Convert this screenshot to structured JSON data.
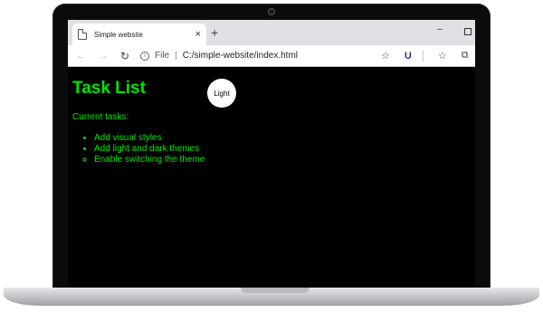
{
  "browser": {
    "tab_title": "Simple website",
    "tab_close": "×",
    "new_tab": "+",
    "minimize": "–",
    "file_label": "File",
    "address_separator": "|",
    "url": "C:/simple-website/index.html",
    "icons": [
      "back-arrow-icon",
      "forward-arrow-icon",
      "reload-icon",
      "info-icon",
      "favorite-star-icon",
      "extension-icon",
      "favorites-icon",
      "collections-icon"
    ]
  },
  "page": {
    "title": "Task List",
    "theme_button_label": "Light",
    "subheading": "Current tasks:",
    "tasks": [
      {
        "label": "Add visual styles",
        "status": "done"
      },
      {
        "label": "Add light and dark themes",
        "status": "done"
      },
      {
        "label": "Enable switching the theme",
        "status": "todo"
      }
    ]
  },
  "colors": {
    "page_background": "#000000",
    "text_accent": "#00e600",
    "toggle_background": "#ffffff"
  }
}
